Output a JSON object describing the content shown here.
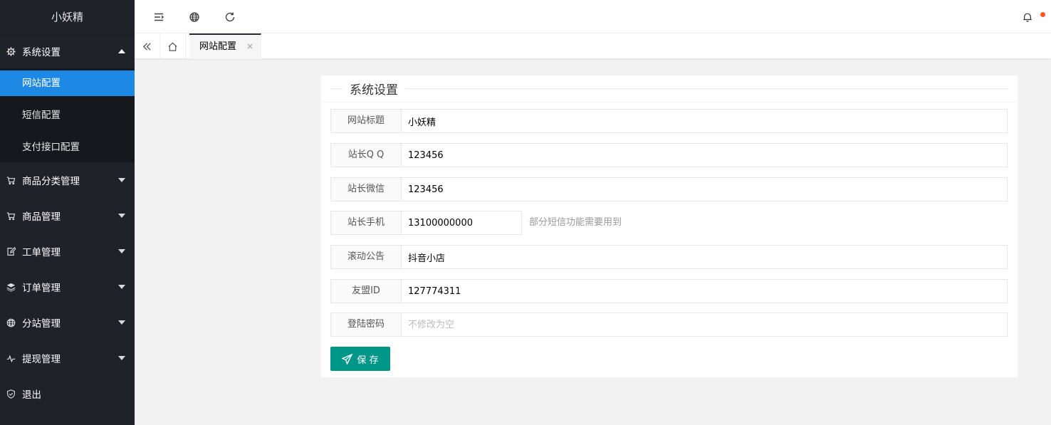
{
  "sidebar": {
    "logo": "小妖精",
    "system": {
      "label": "系统设置",
      "icon": "gear-icon"
    },
    "sub_items": [
      {
        "label": "网站配置"
      },
      {
        "label": "短信配置"
      },
      {
        "label": "支付接口配置"
      }
    ],
    "items": [
      {
        "label": "商品分类管理",
        "icon": "cart-icon"
      },
      {
        "label": "商品管理",
        "icon": "cart-icon"
      },
      {
        "label": "工单管理",
        "icon": "edit-icon"
      },
      {
        "label": "订单管理",
        "icon": "layers-icon"
      },
      {
        "label": "分站管理",
        "icon": "globe-icon"
      },
      {
        "label": "提现管理",
        "icon": "pulse-icon"
      },
      {
        "label": "退出",
        "icon": "shield-icon"
      }
    ]
  },
  "tabs": {
    "active": {
      "label": "网站配置",
      "close": "×"
    }
  },
  "form": {
    "title": "系统设置",
    "fields": [
      {
        "label": "网站标题",
        "value": "小妖精"
      },
      {
        "label": "站长Q Q",
        "value": "123456"
      },
      {
        "label": "站长微信",
        "value": "123456"
      },
      {
        "label": "站长手机",
        "value": "13100000000",
        "aux": "部分短信功能需要用到"
      },
      {
        "label": "滚动公告",
        "value": "抖音小店"
      },
      {
        "label": "友盟ID",
        "value": "127774311"
      },
      {
        "label": "登陆密码",
        "value": "",
        "placeholder": "不修改为空"
      }
    ],
    "save_label": "保 存"
  },
  "colors": {
    "sidebar_bg": "#20222a",
    "active_blue": "#1e88e5",
    "button_teal": "#009688",
    "badge_dot": "#ff5722"
  }
}
